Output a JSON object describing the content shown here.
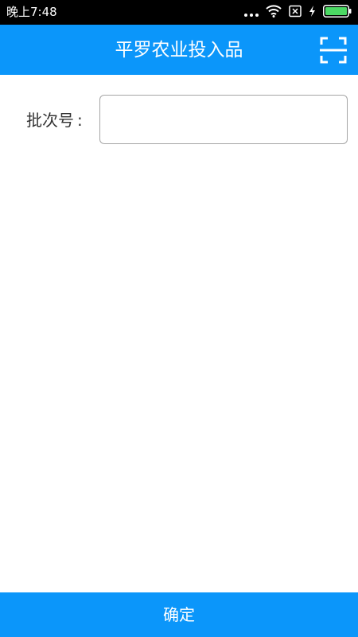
{
  "status_bar": {
    "time": "晚上7:48",
    "icons": [
      "more-dots-icon",
      "wifi-icon",
      "no-sim-icon",
      "charging-icon",
      "battery-icon"
    ]
  },
  "app_bar": {
    "title": "平罗农业投入品",
    "background": "#0b96fa",
    "scan_icon": "scan-icon"
  },
  "form": {
    "batch_label": "批次号",
    "batch_colon": ":",
    "batch_value": "",
    "batch_placeholder": ""
  },
  "footer": {
    "confirm_label": "确定"
  }
}
